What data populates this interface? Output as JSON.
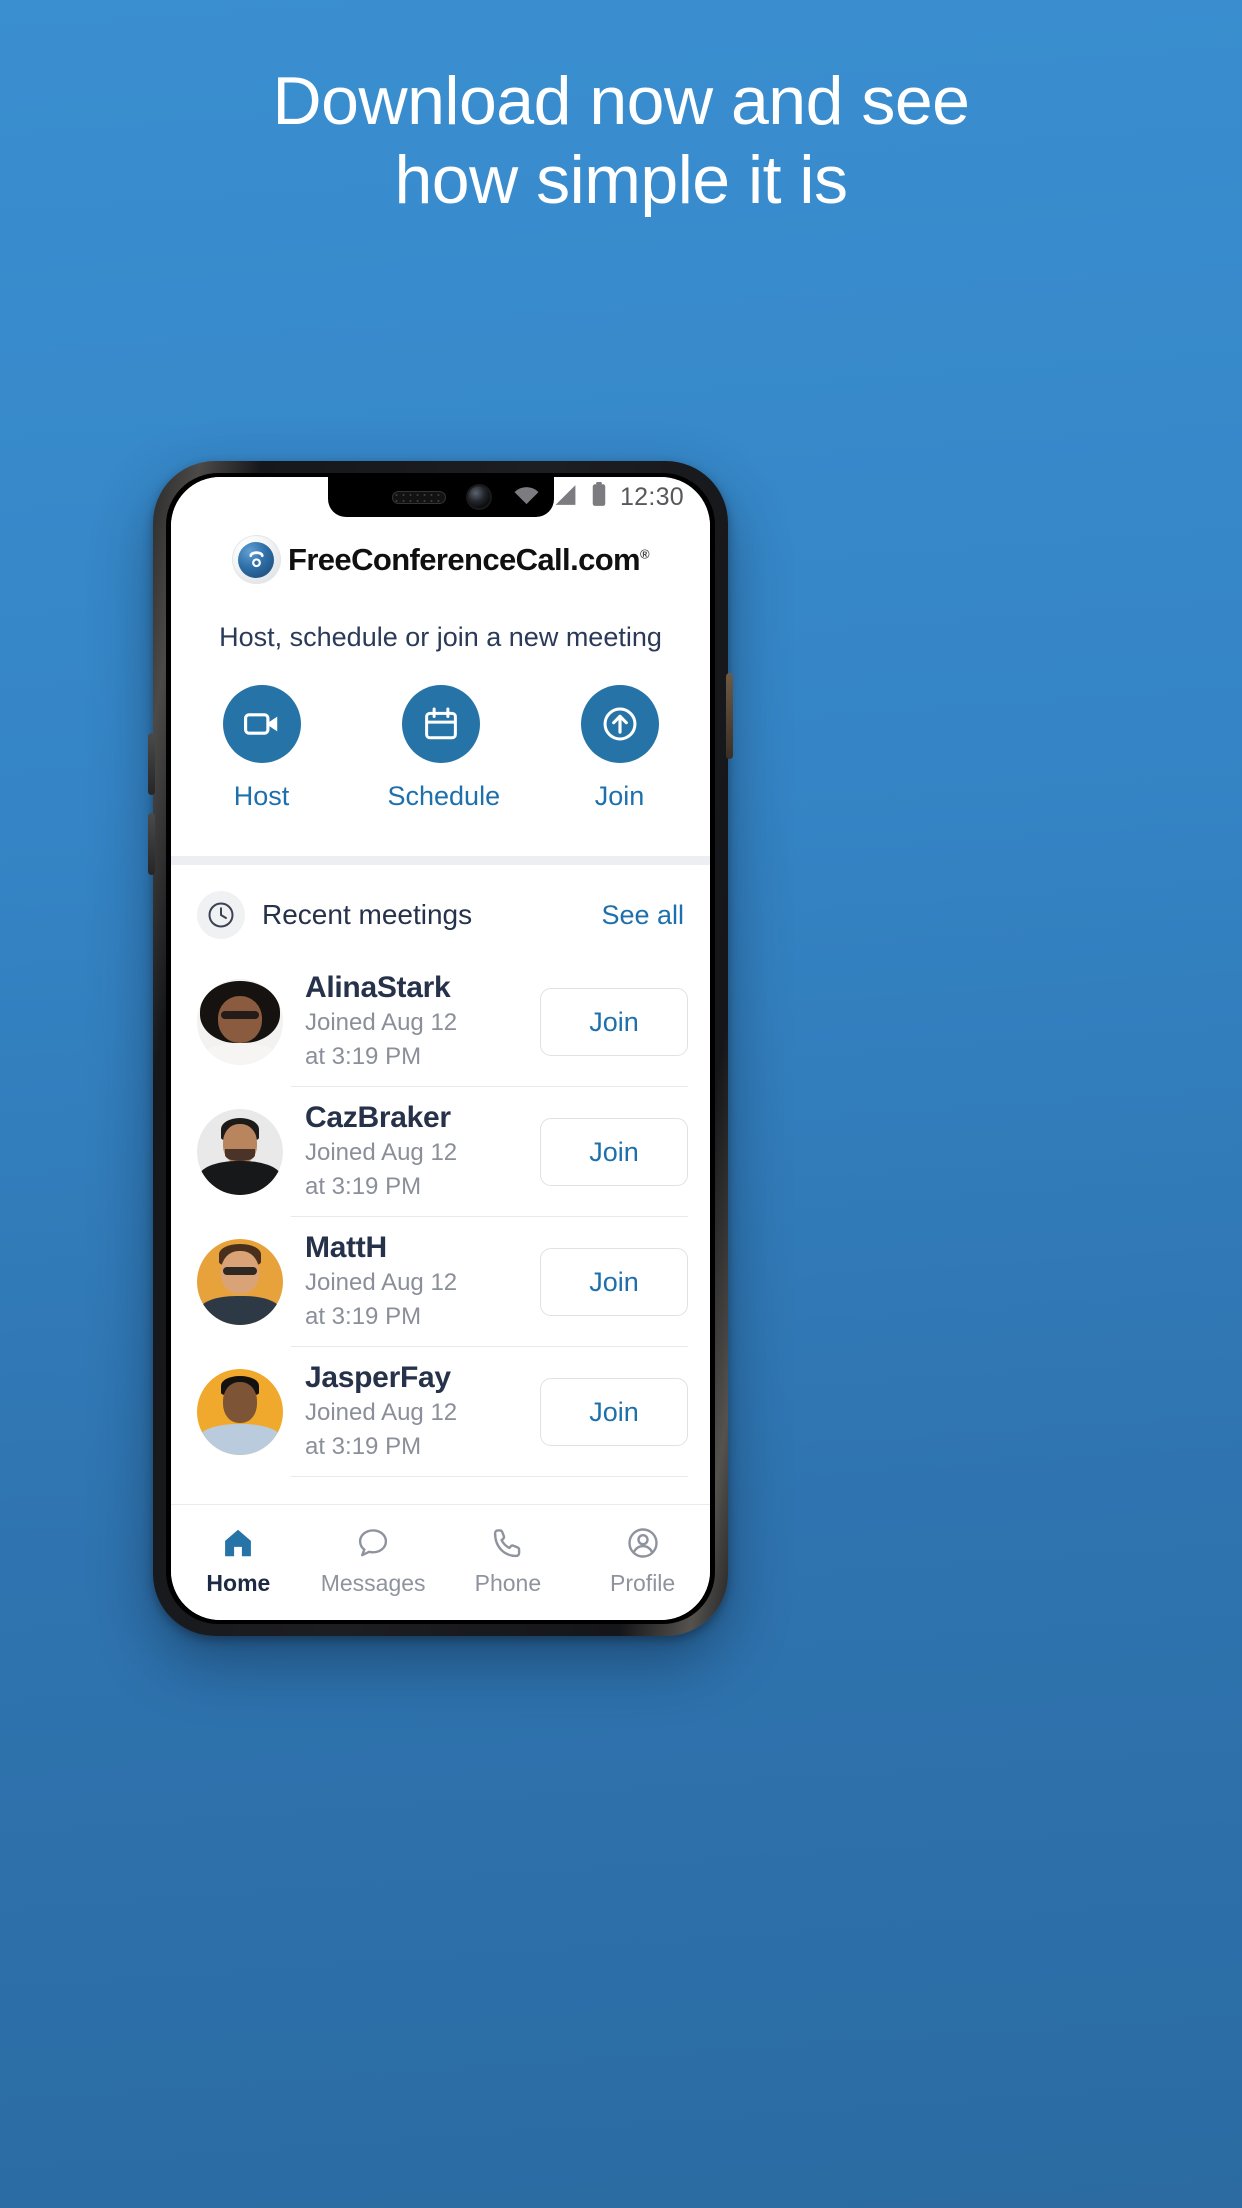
{
  "promo": {
    "headline_line1": "Download now and see",
    "headline_line2": "how simple it is"
  },
  "colors": {
    "background_top": "#3a8fd0",
    "background_bottom": "#2b6ba2",
    "accent_blue": "#1e70ad",
    "button_circle": "#2673a8",
    "text_dark": "#26314a",
    "text_muted": "#8a8f99"
  },
  "status_bar": {
    "time": "12:30",
    "icons": [
      "wifi-icon",
      "cellular-signal-icon",
      "battery-icon"
    ]
  },
  "app": {
    "logo_text": "FreeConferenceCall.com",
    "logo_trademark": "®",
    "logo_icon": "telephone-icon",
    "tagline": "Host, schedule or join a new meeting",
    "actions": [
      {
        "label": "Host",
        "icon": "video-camera-icon"
      },
      {
        "label": "Schedule",
        "icon": "calendar-icon"
      },
      {
        "label": "Join",
        "icon": "arrow-up-circle-icon"
      }
    ],
    "recents": {
      "icon": "clock-icon",
      "title": "Recent meetings",
      "see_all_label": "See all",
      "join_label": "Join",
      "items": [
        {
          "name": "AlinaStark",
          "joined": "Joined Aug 12",
          "time": "at 3:19 PM",
          "join_label": "Join"
        },
        {
          "name": "CazBraker",
          "joined": "Joined Aug 12",
          "time": "at 3:19 PM",
          "join_label": "Join"
        },
        {
          "name": "MattH",
          "joined": "Joined Aug 12",
          "time": "at 3:19 PM",
          "join_label": "Join"
        },
        {
          "name": "JasperFay",
          "joined": "Joined Aug 12",
          "time": "at 3:19 PM",
          "join_label": "Join"
        }
      ]
    },
    "bottom_nav": [
      {
        "label": "Home",
        "icon": "home-icon",
        "active": true
      },
      {
        "label": "Messages",
        "icon": "chat-bubble-icon",
        "active": false
      },
      {
        "label": "Phone",
        "icon": "phone-handset-icon",
        "active": false
      },
      {
        "label": "Profile",
        "icon": "user-circle-icon",
        "active": false
      }
    ]
  }
}
